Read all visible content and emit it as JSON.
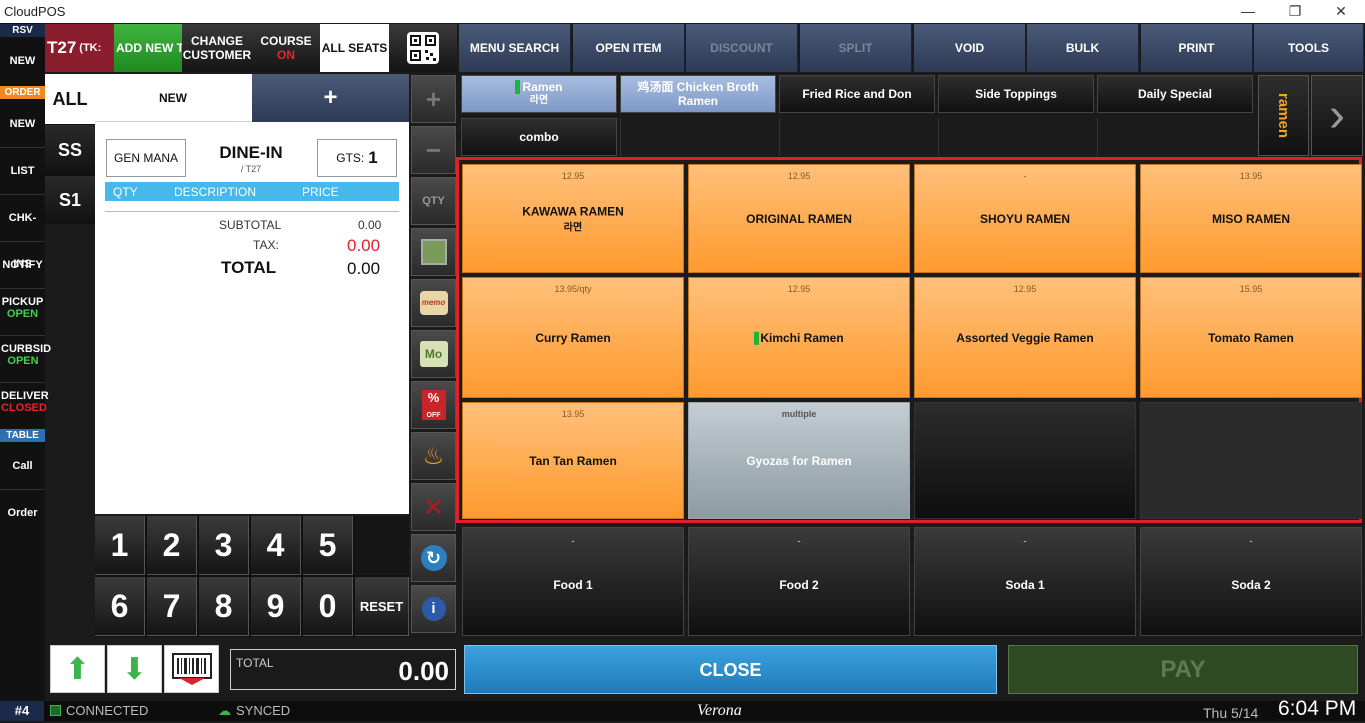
{
  "window": {
    "title": "CloudPOS",
    "minimize": "—",
    "restore": "❐",
    "close": "✕"
  },
  "leftbar": {
    "rsv": "RSV",
    "new1": "NEW",
    "order_tag": "ORDER",
    "new2": "NEW",
    "list": "LIST",
    "chkins": "CHK-INS",
    "notify": "NOTIFY",
    "pickup": "PICKUP",
    "pickup_state": "OPEN",
    "curbside": "CURBSID",
    "curbside_state": "OPEN",
    "delivery": "DELIVER",
    "delivery_state": "CLOSED",
    "table_tag": "TABLE",
    "call": "Call",
    "order": "Order"
  },
  "header": {
    "table": "T27",
    "tk": "(TK:",
    "add_new": "ADD NEW T",
    "change_customer": "CHANGE CUSTOMER",
    "course": "COURSE",
    "course_state": "ON",
    "all_seats": "ALL SEATS"
  },
  "toolbar": [
    "MENU SEARCH",
    "OPEN ITEM",
    "DISCOUNT",
    "SPLIT",
    "VOID",
    "BULK",
    "PRINT",
    "TOOLS"
  ],
  "order_panel": {
    "seats": [
      "ALL",
      "SS",
      "S1"
    ],
    "tab_new": "NEW",
    "tab_plus": "+",
    "server": "GEN MANA",
    "mode": "DINE-IN",
    "mode_sub": "/ T27",
    "guests_label": "GTS:",
    "guests": "1",
    "cols": [
      "QTY",
      "DESCRIPTION",
      "PRICE"
    ],
    "subtotal_label": "SUBTOTAL",
    "subtotal": "0.00",
    "tax_label": "TAX:",
    "tax": "0.00",
    "total_label": "TOTAL",
    "total": "0.00"
  },
  "keypad": {
    "keys": [
      "1",
      "2",
      "3",
      "4",
      "5",
      "6",
      "7",
      "8",
      "9",
      "0"
    ],
    "reset": "RESET"
  },
  "side_tools": {
    "qty": "QTY"
  },
  "categories": [
    {
      "name": "Ramen",
      "sub": "라면"
    },
    {
      "name": "鸡汤面 Chicken Broth Ramen"
    },
    {
      "name": "Fried Rice and Don"
    },
    {
      "name": "Side Toppings"
    },
    {
      "name": "Daily Special"
    },
    {
      "name": "combo"
    }
  ],
  "category_label": "ramen",
  "items": [
    {
      "price": "12.95",
      "name": "KAWAWA RAMEN",
      "sub": "라면"
    },
    {
      "price": "12.95",
      "name": "ORIGINAL RAMEN"
    },
    {
      "price": "-",
      "name": "SHOYU RAMEN"
    },
    {
      "price": "13.95",
      "name": "MISO RAMEN"
    },
    {
      "price": "13.95/qty",
      "name": "Curry Ramen"
    },
    {
      "price": "12.95",
      "name": "Kimchi Ramen"
    },
    {
      "price": "12.95",
      "name": "Assorted Veggie Ramen"
    },
    {
      "price": "15.95",
      "name": "Tomato Ramen"
    },
    {
      "price": "13.95",
      "name": "Tan Tan Ramen"
    },
    {
      "price": "multiple",
      "name": "Gyozas for Ramen"
    }
  ],
  "quick_items": [
    {
      "price": "-",
      "name": "Food 1"
    },
    {
      "price": "-",
      "name": "Food 2"
    },
    {
      "price": "-",
      "name": "Soda 1"
    },
    {
      "price": "-",
      "name": "Soda 2"
    }
  ],
  "footer": {
    "total_label": "TOTAL",
    "total": "0.00",
    "close": "CLOSE",
    "pay": "PAY"
  },
  "status": {
    "station": "#4",
    "connected": "CONNECTED",
    "synced": "SYNCED",
    "user": "Verona",
    "date": "Thu 5/14",
    "time": "6:04 PM"
  },
  "colors": {
    "accent_orange": "#ff9a2e",
    "close_blue": "#2f8fd0",
    "pay_green": "#2e4a22",
    "highlight_red": "#e0202a"
  }
}
